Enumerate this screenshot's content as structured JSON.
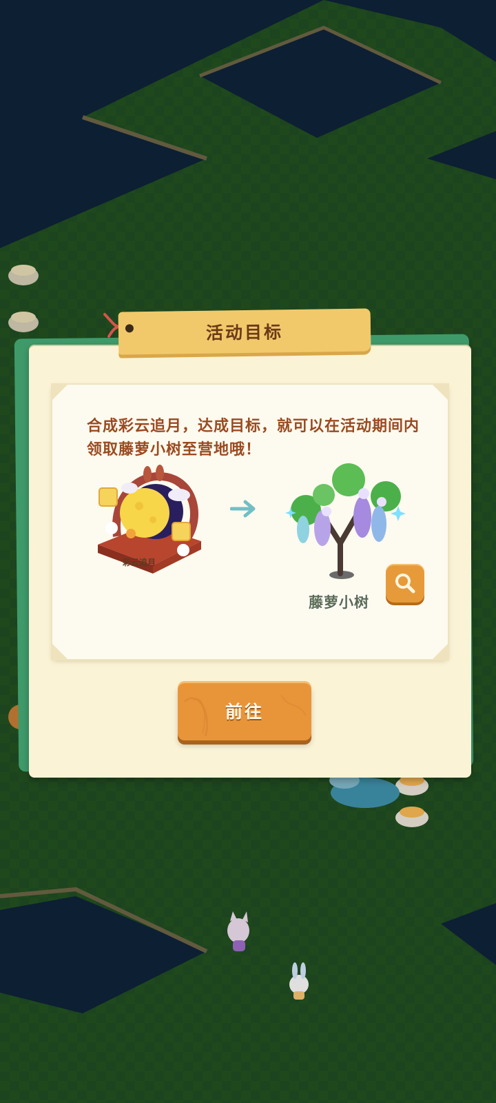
{
  "dialog": {
    "title": "活动目标",
    "description": "合成彩云追月，达成目标，就可以在活动期间内领取藤萝小树至营地哦！",
    "source_item": {
      "name": "彩云追月",
      "icon": "moon-cloud-altar-icon"
    },
    "reward_item": {
      "name": "藤萝小树",
      "icon": "wisteria-tree-icon"
    },
    "arrow_icon": "arrow-right-icon",
    "magnify_icon": "magnifier-icon",
    "go_button_label": "前往"
  },
  "colors": {
    "grass": "#1f4a22",
    "water": "#0f2238",
    "dialog_bg": "#fbf3d6",
    "dialog_border": "#3f9a6a",
    "title_tag": "#f1c96b",
    "description_text": "#9a4a20",
    "button": "#e8953a"
  }
}
